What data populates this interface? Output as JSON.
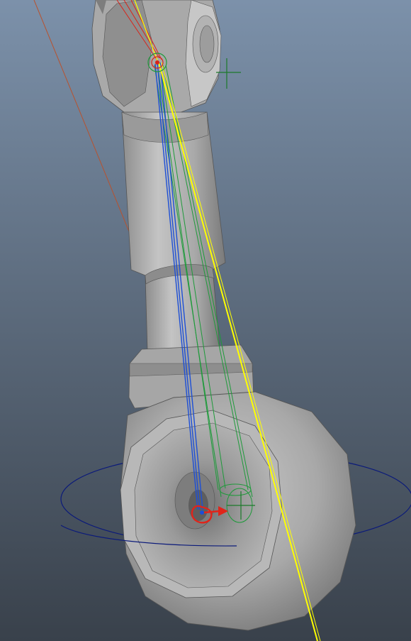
{
  "viewport": {
    "background_top": "#7c91aa",
    "background_bottom": "#39414b",
    "colors": {
      "mesh_light": "#bdbdbd",
      "mesh_mid": "#9f9f9f",
      "mesh_dark": "#6a6a6a",
      "ik_handle": "#ffff00",
      "joint_blue": "#1d4fd6",
      "selection_green": "#1e9a3a",
      "pole_vector_line": "#b8522e",
      "control_circle": "#0b1a7a",
      "manipulator_red": "#e0241a",
      "locator_green": "#1c7a2a"
    },
    "icons": [
      "locator-cross-icon",
      "rotate-manipulator-icon",
      "translate-arrow-icon",
      "joint-icon"
    ]
  }
}
